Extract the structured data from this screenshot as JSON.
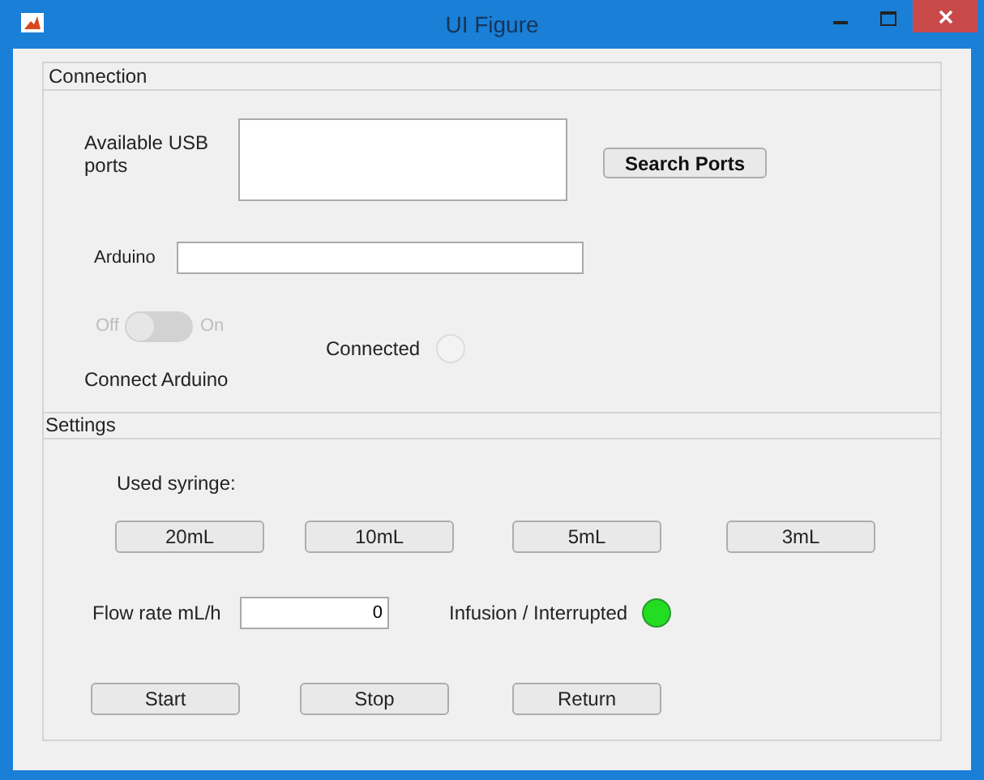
{
  "window": {
    "title": "UI Figure"
  },
  "connection": {
    "title": "Connection",
    "ports_label": "Available USB ports",
    "search_button": "Search Ports",
    "arduino_label": "Arduino",
    "switch": {
      "off_label": "Off",
      "on_label": "On",
      "on": false,
      "disabled": true
    },
    "switch_label": "Connect Arduino",
    "lamp_label": "Connected",
    "lamp_on": false
  },
  "settings": {
    "title": "Settings",
    "syringe_label": "Used syringe:",
    "syringes": [
      {
        "label": "20mL"
      },
      {
        "label": "10mL"
      },
      {
        "label": "5mL"
      },
      {
        "label": "3mL"
      }
    ],
    "flow_label": "Flow rate mL/h",
    "flow_value": "0",
    "lamp_label": "Infusion / Interrupted",
    "lamp_on": true,
    "actions": [
      {
        "label": "Start"
      },
      {
        "label": "Stop"
      },
      {
        "label": "Return"
      }
    ]
  }
}
